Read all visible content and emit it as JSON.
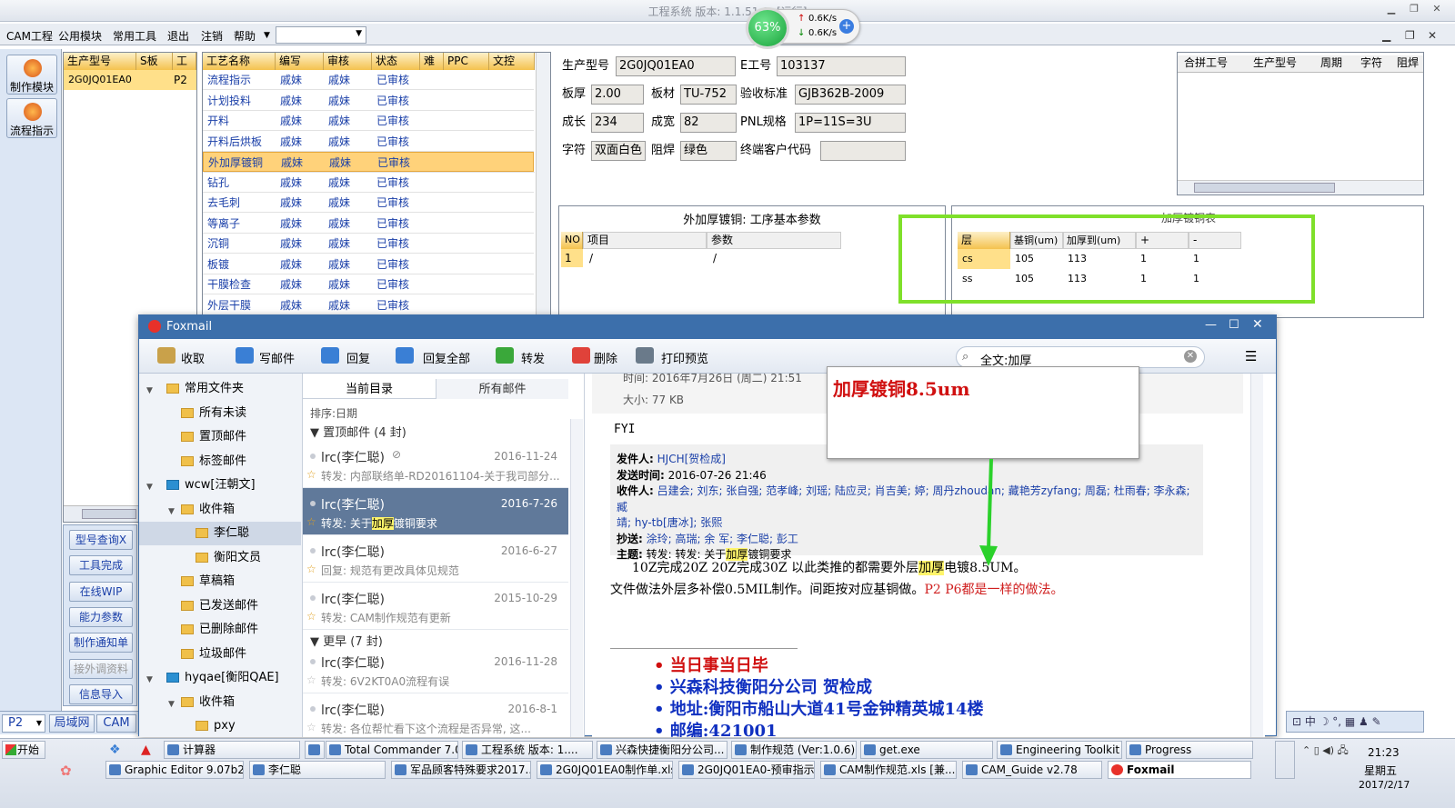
{
  "window": {
    "title": "工程系统   版本: 1.1.51.0   -[运行]"
  },
  "menu": {
    "items": [
      "CAM工程",
      "公用模块",
      "常用工具",
      "退出",
      "注销",
      "帮助"
    ]
  },
  "speed": {
    "percent": "63%",
    "up": "0.6K/s",
    "down": "0.6K/s"
  },
  "left_buttons": [
    "制作模块",
    "流程指示"
  ],
  "products": {
    "headers": [
      "生产型号",
      "S板",
      "工厂"
    ],
    "rows": [
      [
        "2G0JQ01EA0",
        "",
        "P2"
      ]
    ]
  },
  "process": {
    "headers": [
      "工艺名称",
      "编写",
      "审核",
      "状态",
      "难",
      "PPC",
      "文控"
    ],
    "rows": [
      [
        "流程指示",
        "戚妹",
        "戚妹",
        "已审核"
      ],
      [
        "计划投料",
        "戚妹",
        "戚妹",
        "已审核"
      ],
      [
        "开料",
        "戚妹",
        "戚妹",
        "已审核"
      ],
      [
        "开料后烘板",
        "戚妹",
        "戚妹",
        "已审核"
      ],
      [
        "外加厚镀铜",
        "戚妹",
        "戚妹",
        "已审核"
      ],
      [
        "钻孔",
        "戚妹",
        "戚妹",
        "已审核"
      ],
      [
        "去毛刺",
        "戚妹",
        "戚妹",
        "已审核"
      ],
      [
        "等离子",
        "戚妹",
        "戚妹",
        "已审核"
      ],
      [
        "沉铜",
        "戚妹",
        "戚妹",
        "已审核"
      ],
      [
        "板镀",
        "戚妹",
        "戚妹",
        "已审核"
      ],
      [
        "干膜检查",
        "戚妹",
        "戚妹",
        "已审核"
      ],
      [
        "外层干膜",
        "戚妹",
        "戚妹",
        "已审核"
      ]
    ]
  },
  "form": {
    "prod_label": "生产型号",
    "prod": "2G0JQ01EA0",
    "eno_label": "E工号",
    "eno": "103137",
    "thick_label": "板厚",
    "thick": "2.00",
    "mat_label": "板材",
    "mat": "TU-752",
    "std_label": "验收标准",
    "std": "GJB362B-2009",
    "len_label": "成长",
    "len": "234",
    "wid_label": "成宽",
    "wid": "82",
    "pnl_label": "PNL规格",
    "pnl": "1P=11S=3U",
    "char_label": "字符",
    "char": "双面白色",
    "mask_label": "阻焊",
    "mask": "绿色",
    "cust_label": "终端客户代码",
    "cust": ""
  },
  "merge": {
    "headers": [
      "合拼工号",
      "生产型号",
      "周期",
      "字符",
      "阻焊"
    ]
  },
  "params": {
    "title": "外加厚镀铜: 工序基本参数",
    "headers": [
      "NO",
      "项目",
      "参数"
    ],
    "rows": [
      [
        "1",
        "/",
        "/"
      ]
    ]
  },
  "plating": {
    "title": "加厚镀铜表",
    "headers": [
      "层",
      "基铜(um)",
      "加厚到(um)",
      "+",
      "-"
    ],
    "rows": [
      [
        "cs",
        "105",
        "113",
        "1",
        "1"
      ],
      [
        "ss",
        "105",
        "113",
        "1",
        "1"
      ]
    ]
  },
  "side_nav": [
    "型号查询X",
    "工具完成",
    "在线WIP",
    "能力参数",
    "制作通知单",
    "接外调资料",
    "信息导入"
  ],
  "bottom_left": {
    "combo": "P2",
    "tab1": "局域网",
    "tab2": "CAM"
  },
  "foxmail": {
    "title": "Foxmail",
    "toolbar": [
      "收取",
      "写邮件",
      "回复",
      "回复全部",
      "转发",
      "删除",
      "打印预览"
    ],
    "search": "全文:加厚",
    "folders": [
      {
        "label": "常用文件夹",
        "indent": 0
      },
      {
        "label": "所有未读",
        "indent": 1
      },
      {
        "label": "置顶邮件",
        "indent": 1
      },
      {
        "label": "标签邮件",
        "indent": 1
      },
      {
        "label": "wcw[汪朝文]",
        "indent": 0
      },
      {
        "label": "收件箱",
        "indent": 1
      },
      {
        "label": "李仁聪",
        "indent": 2,
        "sel": true
      },
      {
        "label": "衡阳文员",
        "indent": 2
      },
      {
        "label": "草稿箱",
        "indent": 1
      },
      {
        "label": "已发送邮件",
        "indent": 1
      },
      {
        "label": "已删除邮件",
        "indent": 1
      },
      {
        "label": "垃圾邮件",
        "indent": 1
      },
      {
        "label": "hyqae[衡阳QAE]",
        "indent": 0
      },
      {
        "label": "收件箱",
        "indent": 1
      },
      {
        "label": "pxy",
        "indent": 2
      }
    ],
    "tabs": [
      "当前目录",
      "所有邮件"
    ],
    "sort": "排序:日期",
    "group1": "置顶邮件 (4 封)",
    "group2": "更早 (7 封)",
    "messages": [
      {
        "sender": "lrc(李仁聪)",
        "date": "2016-11-24",
        "preview": "转发: 内部联络单-RD20161104-关于我司部分..."
      },
      {
        "sender": "lrc(李仁聪)",
        "date": "2016-7-26",
        "preview_a": "转发: 关于",
        "preview_h": "加厚",
        "preview_b": "镀铜要求"
      },
      {
        "sender": "lrc(李仁聪)",
        "date": "2016-6-27",
        "preview": "回复: 规范有更改具体见规范"
      },
      {
        "sender": "lrc(李仁聪)",
        "date": "2015-10-29",
        "preview": "转发: CAM制作规范有更新"
      },
      {
        "sender": "lrc(李仁聪)",
        "date": "2016-11-28",
        "preview": "转发: 6V2KT0A0流程有误"
      },
      {
        "sender": "lrc(李仁聪)",
        "date": "2016-8-1",
        "preview": "转发: 各位帮忙看下这个流程是否异常, 这..."
      }
    ],
    "mail": {
      "time_line": "时间: 2016年7月26日 (周二) 21:51",
      "size": "大小: 77 KB",
      "fyi": "FYI",
      "from_label": "发件人:",
      "from": "HJCH[贺检成]",
      "sent_label": "发送时间:",
      "sent": "2016-07-26 21:46",
      "to_label": "收件人:",
      "to_a": "吕建会; 刘东; 张自强; 范孝峰; 刘瑶; 陆应灵; 肖吉美; 婷; 周丹zhoudan; 藏艳芳zyfang; 周磊; 杜雨春; 李永森; 臧",
      "to_b": "靖; hy-tb[唐冰]; 张熙",
      "cc_label": "抄送:",
      "cc": "涂玲; 高瑞; 余 军; 李仁聪; 彭工",
      "subj_label": "主题:",
      "subj_a": "转发: 转发: 关于",
      "subj_h": "加厚",
      "subj_b": "镀铜要求",
      "body1_a": "10Z完成20Z 20Z完成30Z 以此类推的都需要外层",
      "body1_h": "加厚",
      "body1_b": "电镀8.5UM。",
      "body2_a": "文件做法外层多补偿0.5MIL制作。间距按对应基铜做。",
      "body2_b": "P2 P6都是一样的做法。",
      "sig": [
        "当日事当日毕",
        "兴森科技衡阳分公司   贺检成",
        "地址:衡阳市船山大道41号金钟精英城14楼",
        "邮编:421001"
      ]
    },
    "callout": "加厚镀铜8.5um"
  },
  "taskbar": {
    "start": "开始",
    "row1": [
      "计算器",
      "",
      "Total Commander 7.0 ...",
      "工程系统  版本: 1....",
      "兴森快捷衡阳分公司...",
      "制作规范 (Ver:1.0.6)",
      "get.exe",
      "Engineering Toolkit 9....",
      "Progress"
    ],
    "row2": [
      "Graphic Editor 9.07b2 (0...",
      "李仁聪",
      "军品顾客特殊要求2017...",
      "2G0JQ01EA0制作单.xls ...",
      "2G0JQ01EA0-预审指示....",
      "CAM制作规范.xls [兼...",
      "CAM_Guide v2.78",
      "Foxmail"
    ],
    "time": "21:23",
    "weekday": "星期五",
    "date": "2017/2/17",
    "ime": "中"
  }
}
